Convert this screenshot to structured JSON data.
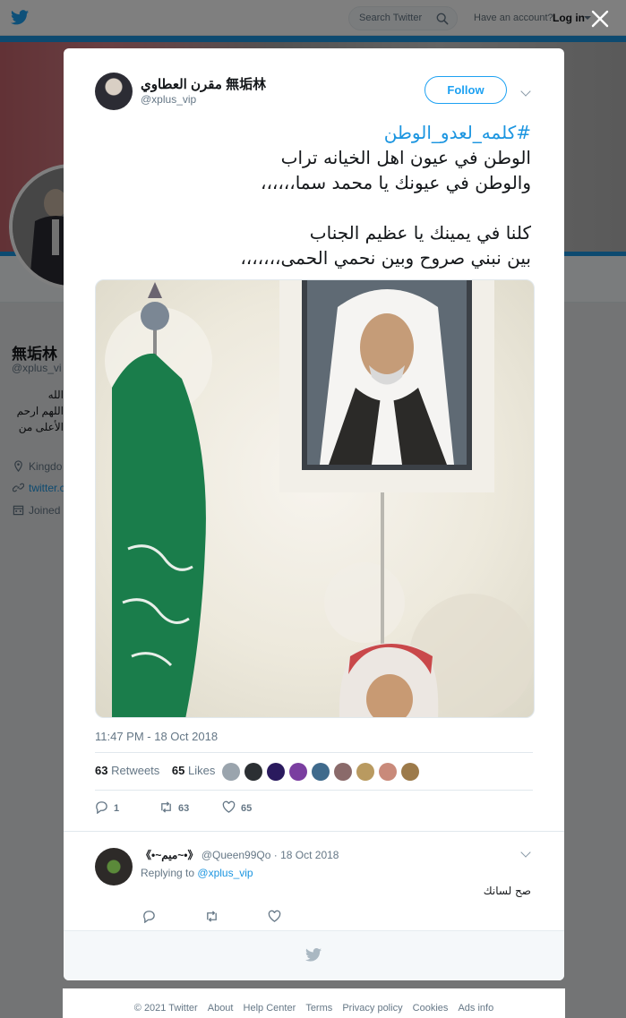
{
  "topnav": {
    "search_placeholder": "Search Twitter",
    "account_prompt": "Have an account?",
    "login_label": "Log in"
  },
  "profile": {
    "name": "無垢林",
    "handle": "@xplus_vi",
    "bio_lines": [
      "الله",
      "اللهم ارحم",
      "الأعلى من"
    ],
    "location": "Kingdo",
    "website": "twitter.c",
    "joined": "Joined"
  },
  "tweet": {
    "author_name": "مقرن العطاوي 無垢林",
    "author_handle": "@xplus_vip",
    "follow_label": "Follow",
    "hashtag": "#كلمه_لعدو_الوطن",
    "lines": [
      "الوطن في عيون اهل الخيانه تراب",
      "والوطن في عيونك يا محمد سما،،،،،،",
      "",
      "كلنا في يمينك يا عظيم الجناب",
      "بين نبني صروح وبين نحمي الحمى،،،،،،،"
    ],
    "timestamp": "11:47 PM - 18 Oct 2018",
    "retweets_count": "63",
    "retweets_label": "Retweets",
    "likes_count": "65",
    "likes_label": "Likes",
    "reply_count": "1",
    "retweet_action_count": "63",
    "like_action_count": "65",
    "liker_colors": [
      "#9aa4ad",
      "#2b2f33",
      "#2a1a5e",
      "#7a3ea0",
      "#3f6a8c",
      "#8a6a6a",
      "#b99a60",
      "#c98a7a",
      "#9c7a4a"
    ]
  },
  "reply": {
    "name": "《•~ميم~•》",
    "handle": "@Queen99Qo",
    "date": "18 Oct 2018",
    "replying_label": "Replying to",
    "replying_handle": "@xplus_vip",
    "text": "صح لسانك"
  },
  "footer": {
    "links": [
      "© 2021 Twitter",
      "About",
      "Help Center",
      "Terms",
      "Privacy policy",
      "Cookies",
      "Ads info"
    ]
  },
  "colors": {
    "accent": "#1da1f2",
    "link": "#1b95e0",
    "flag_green": "#1a7d4b"
  }
}
